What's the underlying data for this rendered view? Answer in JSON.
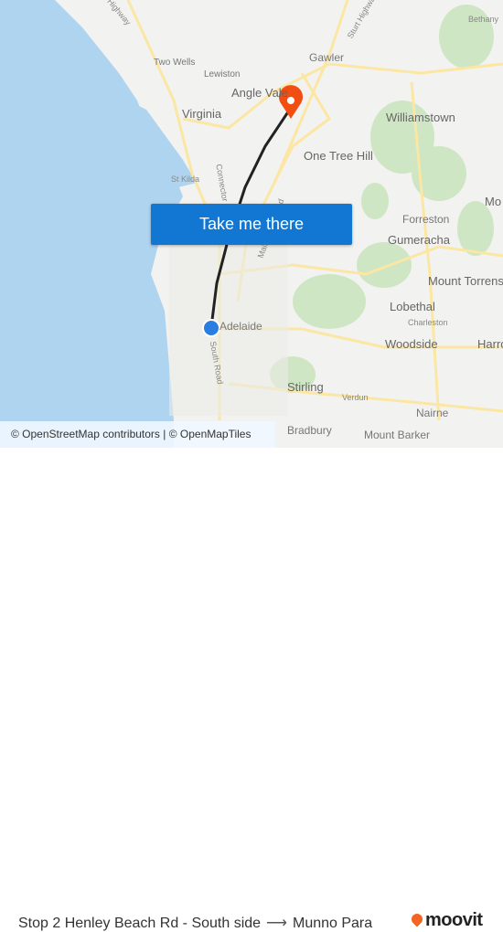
{
  "map": {
    "labels": {
      "two_wells": "Two Wells",
      "lewiston": "Lewiston",
      "gawler": "Gawler",
      "angle_vale": "Angle Vale",
      "virginia": "Virginia",
      "williamstown": "Williamstown",
      "one_tree_hill": "One Tree Hill",
      "st_kilda": "St Kilda",
      "forreston": "Forreston",
      "gumeracha": "Gumeracha",
      "mount_torrens": "Mount Torrens",
      "lobethal": "Lobethal",
      "charleston": "Charleston",
      "woodside": "Woodside",
      "adelaide": "Adelaide",
      "stirling": "Stirling",
      "verdun": "Verdun",
      "nairne": "Nairne",
      "bradbury": "Bradbury",
      "mount_barker": "Mount Barker",
      "bethany": "Bethany",
      "south_road": "South Road",
      "connector": "Connector",
      "main_north_road": "Main North Road",
      "sturt_highway": "Sturt Highway",
      "highway": "Highway",
      "harrogate": "Harro",
      "mo": "Mo"
    },
    "colors": {
      "water": "#aed4f0",
      "land": "#f2f2f0",
      "park": "#cfe6c4",
      "road": "#fbe7a3",
      "route": "#222222",
      "origin": "#2a7de1",
      "destination": "#f04e12"
    },
    "origin_icon": "origin-dot-icon",
    "destination_icon": "destination-pin-icon"
  },
  "cta": {
    "label": "Take me there"
  },
  "attribution": "© OpenStreetMap contributors | © OpenMapTiles",
  "footer": {
    "origin": "Stop 2 Henley Beach Rd - South side",
    "arrow": "⟶",
    "destination": "Munno Para",
    "brand": "moovit"
  }
}
